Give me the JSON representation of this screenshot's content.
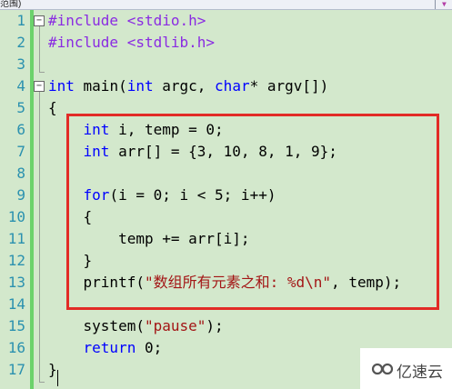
{
  "toolbar": {
    "label": "范围)",
    "dropdown_icon": "chevron-down-icon"
  },
  "editor": {
    "line_numbers": [
      "1",
      "2",
      "3",
      "4",
      "5",
      "6",
      "7",
      "8",
      "9",
      "10",
      "11",
      "12",
      "13",
      "14",
      "15",
      "16",
      "17"
    ],
    "lines": [
      [
        {
          "t": "#include ",
          "c": "inc"
        },
        {
          "t": "<stdio.h>",
          "c": "inc"
        }
      ],
      [
        {
          "t": "#include ",
          "c": "inc"
        },
        {
          "t": "<stdlib.h>",
          "c": "inc"
        }
      ],
      [],
      [
        {
          "t": "int",
          "c": "kw"
        },
        {
          "t": " main(",
          "c": ""
        },
        {
          "t": "int",
          "c": "kw"
        },
        {
          "t": " argc, ",
          "c": ""
        },
        {
          "t": "char",
          "c": "kw"
        },
        {
          "t": "* argv[])",
          "c": ""
        }
      ],
      [
        {
          "t": "{",
          "c": ""
        }
      ],
      [
        {
          "t": "    ",
          "c": ""
        },
        {
          "t": "int",
          "c": "kw"
        },
        {
          "t": " i, temp = 0;",
          "c": ""
        }
      ],
      [
        {
          "t": "    ",
          "c": ""
        },
        {
          "t": "int",
          "c": "kw"
        },
        {
          "t": " arr[] = {3, 10, 8, 1, 9};",
          "c": ""
        }
      ],
      [],
      [
        {
          "t": "    ",
          "c": ""
        },
        {
          "t": "for",
          "c": "kw"
        },
        {
          "t": "(i = 0; i < 5; i++)",
          "c": ""
        }
      ],
      [
        {
          "t": "    {",
          "c": ""
        }
      ],
      [
        {
          "t": "        temp += arr[i];",
          "c": ""
        }
      ],
      [
        {
          "t": "    }",
          "c": ""
        }
      ],
      [
        {
          "t": "    printf(",
          "c": ""
        },
        {
          "t": "\"数组所有元素之和: %d\\n\"",
          "c": "str"
        },
        {
          "t": ", temp);",
          "c": ""
        }
      ],
      [],
      [
        {
          "t": "    system(",
          "c": ""
        },
        {
          "t": "\"pause\"",
          "c": "str"
        },
        {
          "t": ");",
          "c": ""
        }
      ],
      [
        {
          "t": "    ",
          "c": ""
        },
        {
          "t": "return",
          "c": "kw"
        },
        {
          "t": " 0;",
          "c": ""
        }
      ],
      [
        {
          "t": "}",
          "c": ""
        }
      ]
    ],
    "fold_markers": {
      "1": "−",
      "4": "−"
    }
  },
  "watermark": {
    "text": "亿速云",
    "icon": "yisu-cloud-logo-icon"
  },
  "colors": {
    "background": "#d3e8cc",
    "line_number": "#2b91af",
    "keyword": "#0000ff",
    "preprocessor": "#8a2be2",
    "string": "#a31515",
    "change_bar": "#6bd26b",
    "highlight_border": "#e22b26"
  }
}
